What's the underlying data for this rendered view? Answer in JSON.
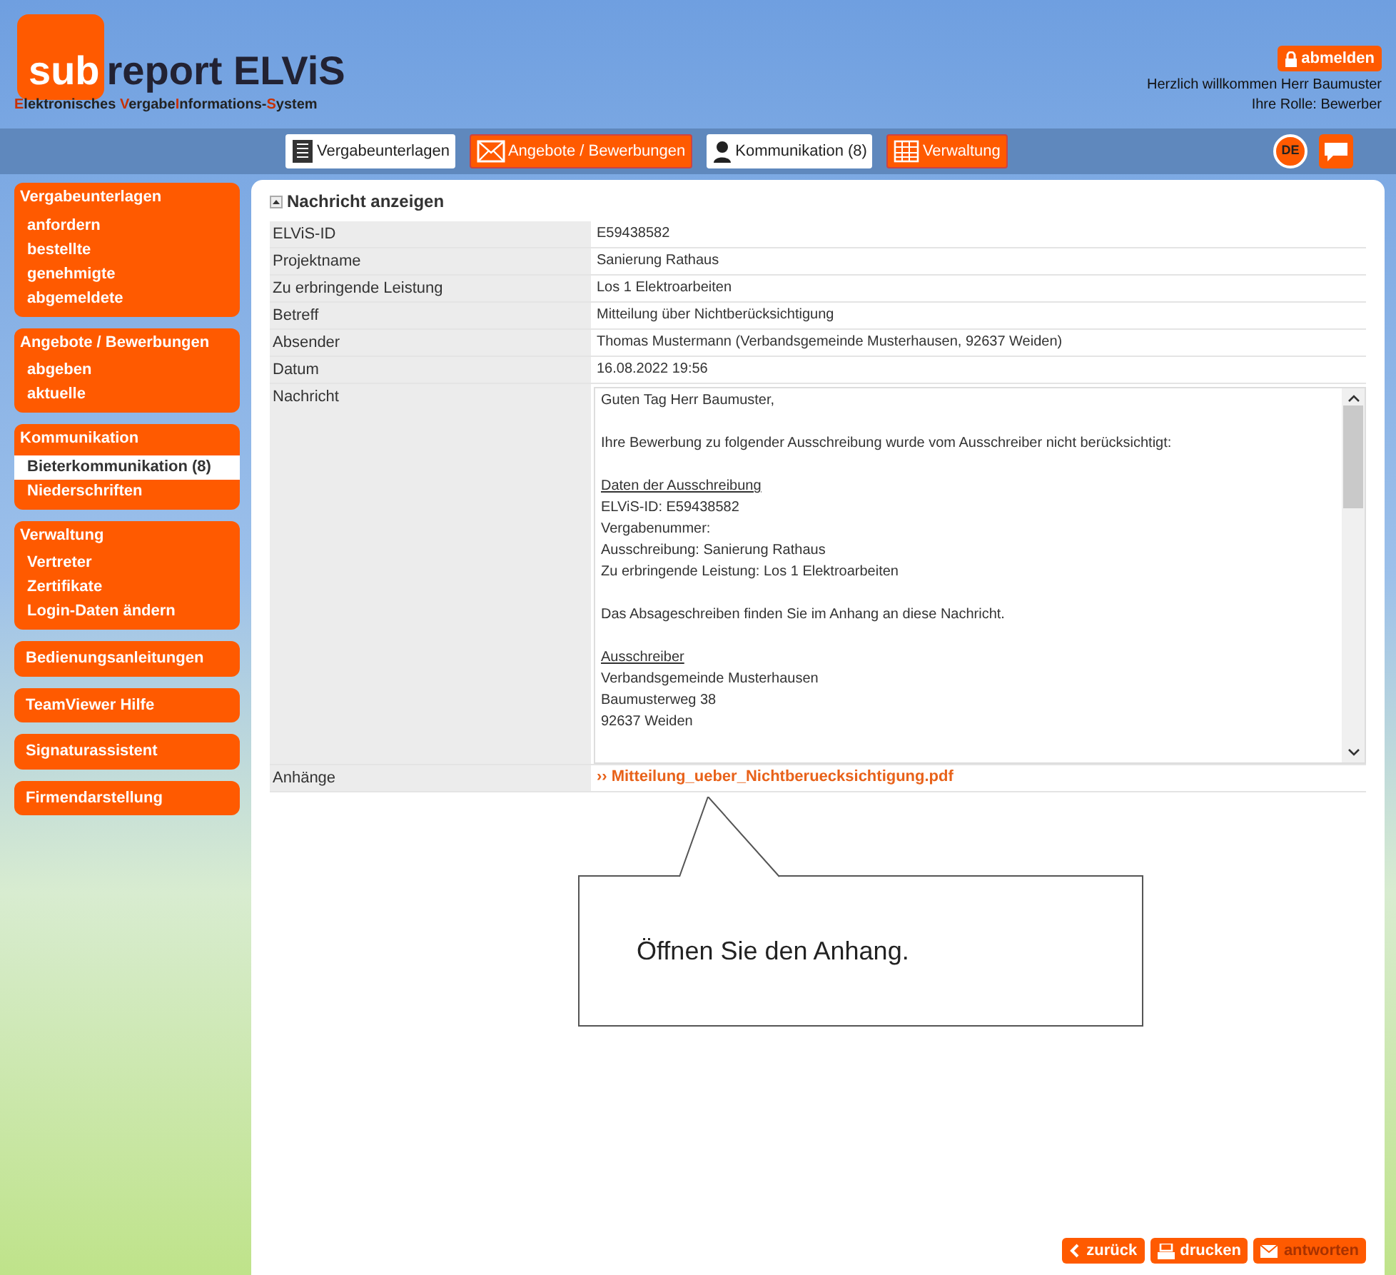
{
  "logo": {
    "brand_accent": "sub",
    "brand_rest": "report ELViS",
    "tagline": [
      {
        "text": "E",
        "accent": true
      },
      {
        "text": "lektronisches ",
        "accent": false
      },
      {
        "text": "V",
        "accent": true
      },
      {
        "text": "ergabe",
        "accent": false
      },
      {
        "text": "I",
        "accent": true
      },
      {
        "text": "nformations-",
        "accent": false
      },
      {
        "text": "S",
        "accent": true
      },
      {
        "text": "ystem",
        "accent": false
      }
    ]
  },
  "user": {
    "logout": "abmelden",
    "welcome": "Herzlich willkommen Herr Baumuster",
    "role": "Ihre Rolle: Bewerber"
  },
  "top_nav": [
    {
      "label": "Vergabeunterlagen",
      "highlighted": true
    },
    {
      "label": "Angebote / Bewerbungen",
      "highlighted": false
    },
    {
      "label": "Kommunikation (8)",
      "highlighted": true
    },
    {
      "label": "Verwaltung",
      "highlighted": false
    }
  ],
  "language": "DE",
  "sidebar": [
    {
      "title": "Vergabeunterlagen",
      "items": [
        {
          "label": "anfordern",
          "selected": false
        },
        {
          "label": "bestellte",
          "selected": false
        },
        {
          "label": "genehmigte",
          "selected": false
        },
        {
          "label": "abgemeldete",
          "selected": false
        }
      ]
    },
    {
      "title": "Angebote / Bewerbungen",
      "items": [
        {
          "label": "abgeben",
          "selected": false
        },
        {
          "label": "aktuelle",
          "selected": false
        }
      ]
    },
    {
      "title": "Kommunikation",
      "items": [
        {
          "label": "Bieterkommunikation (8)",
          "selected": true
        },
        {
          "label": "Niederschriften",
          "selected": false
        }
      ]
    },
    {
      "title": "Verwaltung",
      "items": [
        {
          "label": "Vertreter",
          "selected": false
        },
        {
          "label": "Zertifikate",
          "selected": false
        },
        {
          "label": "Login-Daten ändern",
          "selected": false
        }
      ]
    },
    {
      "title": "Bedienungsanleitungen"
    },
    {
      "title": "TeamViewer Hilfe"
    },
    {
      "title": "Signaturassistent"
    },
    {
      "title": "Firmendarstellung"
    }
  ],
  "section_title": "Nachricht anzeigen",
  "fields": [
    {
      "label": "ELViS-ID",
      "value": "E59438582"
    },
    {
      "label": "Projektname",
      "value": "Sanierung Rathaus"
    },
    {
      "label": "Zu erbringende Leistung",
      "value": "Los 1 Elektroarbeiten"
    },
    {
      "label": "Betreff",
      "value": "Mitteilung über Nichtberücksichtigung"
    },
    {
      "label": "Absender",
      "value": "Thomas Mustermann (Verbandsgemeinde Musterhausen, 92637 Weiden)"
    },
    {
      "label": "Datum",
      "value": "16.08.2022 19:56"
    }
  ],
  "message": {
    "label": "Nachricht",
    "lines": [
      {
        "text": "Guten Tag Herr Baumuster,",
        "kind": "text",
        "gap_before": false
      },
      {
        "text": "Ihre Bewerbung zu folgender Ausschreibung wurde vom Ausschreiber nicht berücksichtigt:",
        "kind": "text",
        "gap_before": true
      },
      {
        "text": "Daten der Ausschreibung",
        "kind": "heading",
        "gap_before": true
      },
      {
        "text": "ELViS-ID: E59438582",
        "kind": "text",
        "gap_before": false
      },
      {
        "text": "Vergabenummer:",
        "kind": "text",
        "gap_before": false
      },
      {
        "text": "Ausschreibung: Sanierung Rathaus",
        "kind": "text",
        "gap_before": false
      },
      {
        "text": "Zu erbringende Leistung: Los 1 Elektroarbeiten",
        "kind": "text",
        "gap_before": false
      },
      {
        "text": "Das Absageschreiben finden Sie im Anhang an diese Nachricht.",
        "kind": "text",
        "gap_before": true
      },
      {
        "text": "Ausschreiber",
        "kind": "heading",
        "gap_before": true
      },
      {
        "text": "Verbandsgemeinde Musterhausen",
        "kind": "text",
        "gap_before": false
      },
      {
        "text": "Baumusterweg 38",
        "kind": "text",
        "gap_before": false
      },
      {
        "text": "92637 Weiden",
        "kind": "text",
        "gap_before": false
      }
    ]
  },
  "attachments": {
    "label": "Anhänge",
    "marker": "››",
    "file": "Mitteilung_ueber_Nichtberuecksichtigung.pdf"
  },
  "callout": "Öffnen Sie den Anhang.",
  "actions": [
    {
      "label": "zurück",
      "disabled": false
    },
    {
      "label": "drucken",
      "disabled": false
    },
    {
      "label": "antworten",
      "disabled": true
    }
  ]
}
